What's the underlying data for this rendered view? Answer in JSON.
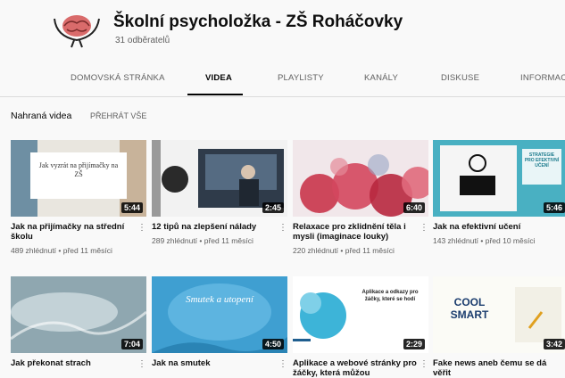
{
  "channel": {
    "title": "Školní psycholožka - ZŠ Roháčovky",
    "subscribers": "31 odběratelů"
  },
  "tabs": [
    "DOMOVSKÁ STRÁNKA",
    "VIDEA",
    "PLAYLISTY",
    "KANÁLY",
    "DISKUSE",
    "INFORMACE"
  ],
  "active_tab": "VIDEA",
  "section": {
    "title": "Nahraná videa",
    "play_all": "PŘEHRÁT VŠE"
  },
  "videos": [
    {
      "title": "Jak na přijímačky na střední školu",
      "meta": "489 zhlédnutí • před 11 měsíci",
      "duration": "5:44",
      "thumb_text": "Jak vyzrát na přijímačky na ZŠ"
    },
    {
      "title": "12 tipů na zlepšení nálady",
      "meta": "289 zhlédnutí • před 11 měsíci",
      "duration": "2:45",
      "thumb_text": ""
    },
    {
      "title": "Relaxace pro zklidnění těla i mysli (imaginace louky)",
      "meta": "220 zhlédnutí • před 11 měsíci",
      "duration": "6:40",
      "thumb_text": ""
    },
    {
      "title": "Jak na efektivní učení",
      "meta": "143 zhlédnutí • před 10 měsíci",
      "duration": "5:46",
      "thumb_text": "STRATEGIE PRO EFEKTIVNÍ UČENÍ"
    },
    {
      "title": "Jak překonat strach",
      "meta": "",
      "duration": "7:04",
      "thumb_text": ""
    },
    {
      "title": "Jak na smutek",
      "meta": "",
      "duration": "4:50",
      "thumb_text": "Smutek a utopení"
    },
    {
      "title": "Aplikace a webové stránky pro žáčky, která můžou",
      "meta": "",
      "duration": "2:29",
      "thumb_text": "Aplikace a odkazy pro žáčky, které se hodí"
    },
    {
      "title": "Fake news aneb čemu se dá věřit",
      "meta": "",
      "duration": "3:42",
      "thumb_text": "COOL SMART"
    }
  ],
  "colors": {
    "bg": "#f9f9f9",
    "text": "#030303",
    "muted": "#606060"
  }
}
